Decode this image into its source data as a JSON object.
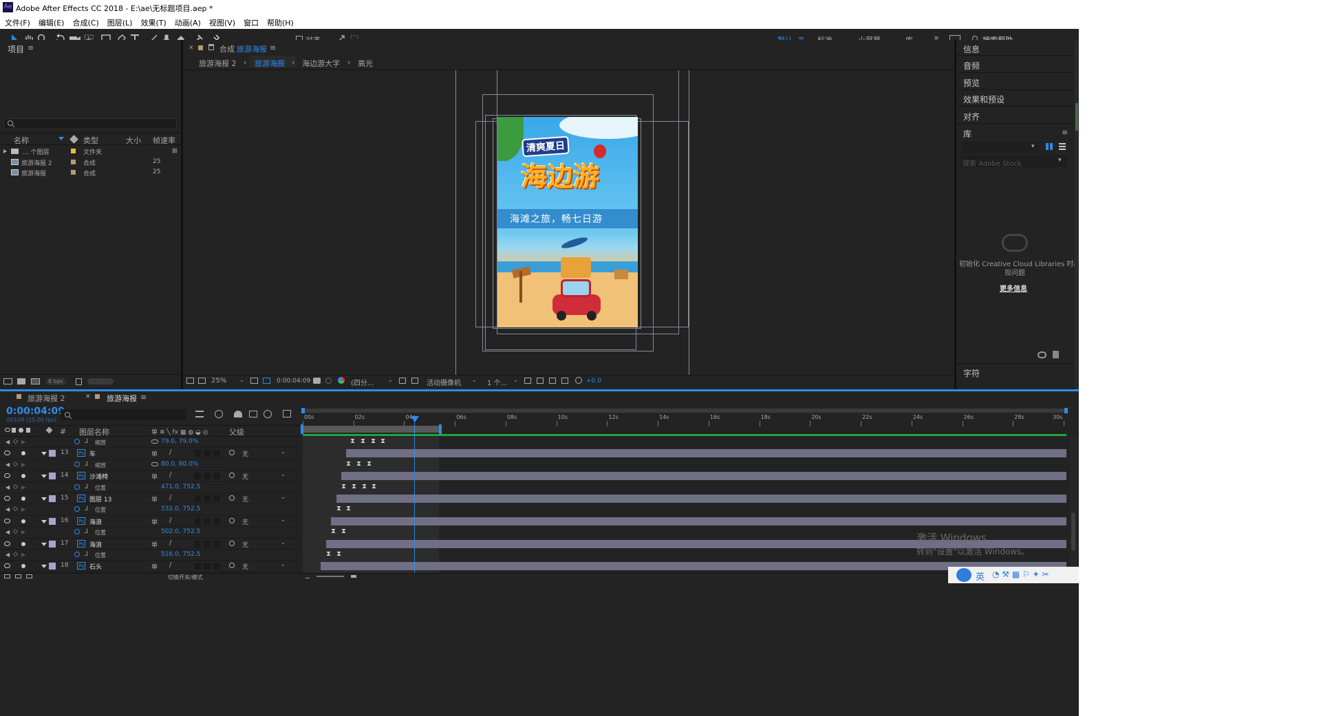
{
  "title": "Adobe After Effects CC 2018 - E:\\ae\\无标题项目.aep *",
  "menu": [
    "文件(F)",
    "编辑(E)",
    "合成(C)",
    "图层(L)",
    "效果(T)",
    "动画(A)",
    "视图(V)",
    "窗口",
    "帮助(H)"
  ],
  "toolbar": {
    "align_label": "对齐",
    "workspaces": [
      "默认",
      "标准",
      "小屏幕",
      "库"
    ],
    "search_help": "搜索帮助"
  },
  "project": {
    "title": "项目",
    "columns": [
      "名称",
      "类型",
      "大小",
      "帧速率"
    ],
    "items": [
      {
        "name": "... 个图层",
        "type": "文件夹",
        "fps": ""
      },
      {
        "name": "旅游海报 2",
        "type": "合成",
        "fps": "25"
      },
      {
        "name": "旅游海报",
        "type": "合成",
        "fps": "25"
      }
    ],
    "bpc": "8 bpc"
  },
  "comp": {
    "tab_prefix": "合成",
    "tab_name": "旅游海报",
    "breadcrumb": [
      "旅游海报 2",
      "旅游海报",
      "海边游大字",
      "高光"
    ],
    "zoom": "25%",
    "timecode": "0:00:04:09",
    "resolution": "(四分...",
    "camera": "活动摄像机",
    "views": "1 个...",
    "exposure": "+0.0"
  },
  "poster": {
    "tagline": "清爽夏日",
    "headline": "海边游",
    "slogan": "海滩之旅，畅七日游"
  },
  "right_panel": {
    "items": [
      "信息",
      "音频",
      "预览",
      "效果和预设",
      "对齐"
    ],
    "library": "库",
    "search_stock": "搜索 Adobe Stock",
    "cc_msg_line1": "初始化 Creative Cloud Libraries 时出",
    "cc_msg_line2": "现问题",
    "more_info": "更多信息",
    "char": "字符"
  },
  "timeline": {
    "tabs": [
      "旅游海报 2",
      "旅游海报"
    ],
    "timecode": "0:00:04:09",
    "fps_info": "00109 (25.00 fps)",
    "col_layer": "图层名称",
    "col_parent": "父级",
    "ruler": [
      "00s",
      "02s",
      "04s",
      "06s",
      "08s",
      "10s",
      "12s",
      "14s",
      "16s",
      "18s",
      "20s",
      "22s",
      "24s",
      "26s",
      "28s",
      "30s"
    ],
    "switch_mode": "切换开关/模式",
    "rows": [
      {
        "type": "prop",
        "name": "缩放",
        "value": "79.0, 79.0%"
      },
      {
        "type": "layer",
        "num": "13",
        "name": "车",
        "parent": "无"
      },
      {
        "type": "prop",
        "name": "缩放",
        "value": "80.0, 80.0%"
      },
      {
        "type": "layer",
        "num": "14",
        "name": "沙滩椅",
        "parent": "无"
      },
      {
        "type": "prop",
        "name": "位置",
        "value": "471.0, 752.5"
      },
      {
        "type": "layer",
        "num": "15",
        "name": "图层 13",
        "parent": "无"
      },
      {
        "type": "prop",
        "name": "位置",
        "value": "532.0, 752.5"
      },
      {
        "type": "layer",
        "num": "16",
        "name": "海浪",
        "parent": "无"
      },
      {
        "type": "prop",
        "name": "位置",
        "value": "502.0, 752.5"
      },
      {
        "type": "layer",
        "num": "17",
        "name": "海浪",
        "parent": "无"
      },
      {
        "type": "prop",
        "name": "位置",
        "value": "516.0, 752.5"
      },
      {
        "type": "layer",
        "num": "18",
        "name": "石头",
        "parent": "无"
      }
    ]
  },
  "watermark": {
    "line1": "激活 Windows",
    "line2": "转到\"设置\"以激活 Windows。"
  },
  "taskbar": {
    "ime": "英"
  }
}
